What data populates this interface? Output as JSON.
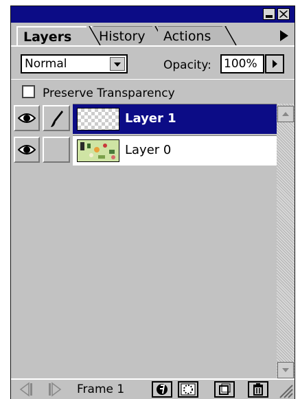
{
  "palette": {
    "tabs": [
      {
        "label": "Layers",
        "active": true
      },
      {
        "label": "History",
        "active": false
      },
      {
        "label": "Actions",
        "active": false
      }
    ]
  },
  "controls": {
    "blend_mode": "Normal",
    "opacity_label": "Opacity:",
    "opacity_value": "100%",
    "preserve_label": "Preserve Transparency",
    "preserve_checked": false
  },
  "layers": [
    {
      "name": "Layer 1",
      "selected": true,
      "visible": true,
      "thumbnail": "transparent-checker"
    },
    {
      "name": "Layer 0",
      "selected": false,
      "visible": true,
      "thumbnail": "image"
    }
  ],
  "footer": {
    "frame_label": "Frame 1"
  },
  "colors": {
    "titlebar": "#0c0c86",
    "selection": "#0c0c86",
    "panel": "#c2c2c2"
  },
  "icons": [
    "close-icon",
    "minimize-icon",
    "palette-menu-arrow-icon",
    "eye-icon",
    "paintbrush-icon",
    "effects-icon",
    "mask-icon",
    "new-layer-icon",
    "trash-icon"
  ]
}
